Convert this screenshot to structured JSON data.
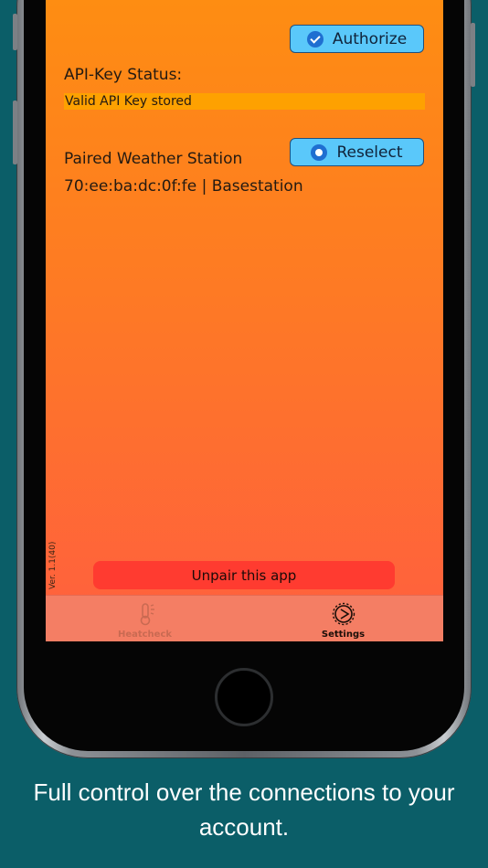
{
  "settings": {
    "authorize_label": "Authorize",
    "api_key_status_title": "API-Key Status:",
    "api_key_status_value": "Valid API Key stored",
    "paired_station_title": "Paired Weather Station",
    "reselect_label": "Reselect",
    "station_value": "70:ee:ba:dc:0f:fe | Basestation",
    "version": "Ver. 1.1(40)",
    "unpair_label": "Unpair this app"
  },
  "tabbar": {
    "tabs": [
      {
        "label": "Heatcheck",
        "icon": "thermometer-icon",
        "selected": false
      },
      {
        "label": "Settings",
        "icon": "gear-icon",
        "selected": true
      }
    ]
  },
  "caption": {
    "line1": "Full control over the connections to your",
    "line2": "account."
  },
  "colors": {
    "background": "#0b5e68",
    "accent_button": "#5ac8fa",
    "unpair_button": "#ff3b30",
    "status_bar": "#fea101"
  }
}
